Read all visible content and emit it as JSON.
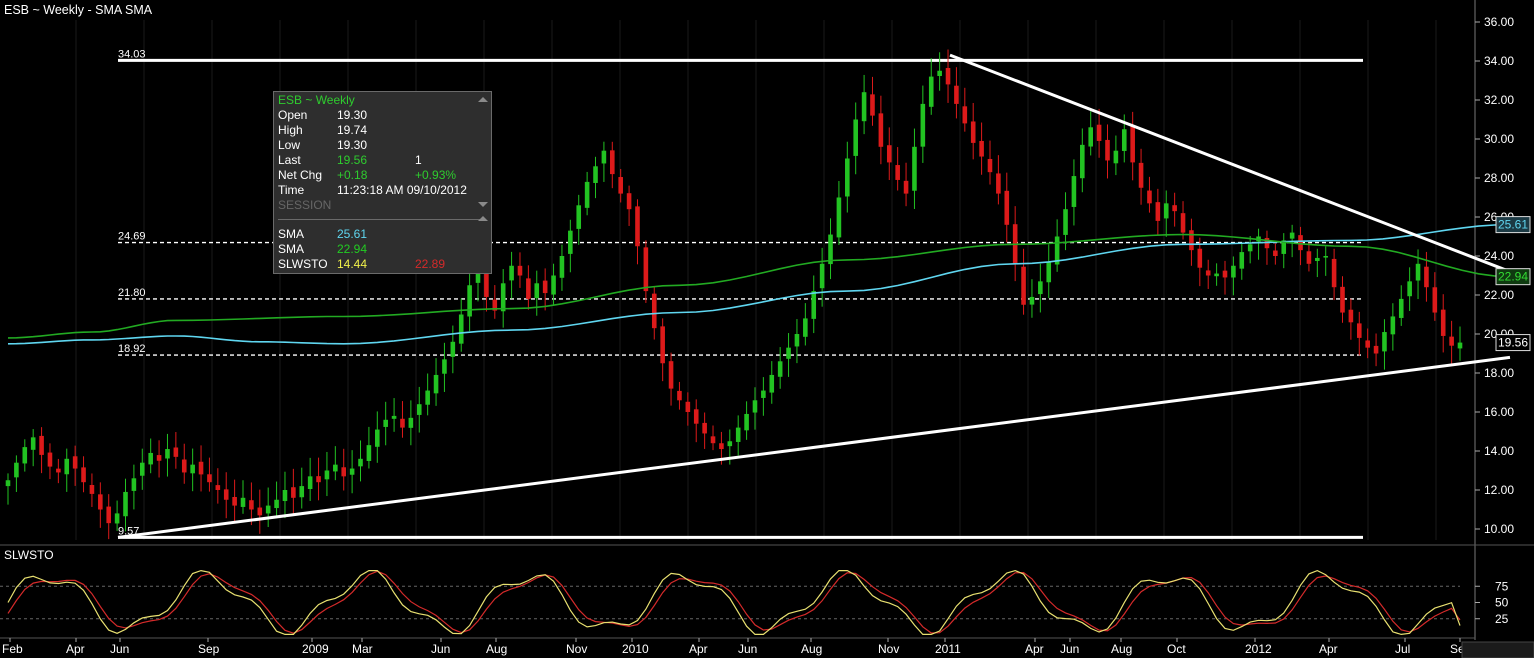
{
  "header": {
    "title": "ESB ~ Weekly  -  SMA SMA"
  },
  "colors": {
    "up": "#22c322",
    "down": "#dd1a1a",
    "sma_long": "#5fd6f0",
    "sma_short": "#22aa22",
    "stoch_k": "#e8e070",
    "stoch_d": "#d42a2a",
    "lines": "#ffffff"
  },
  "tooltip": {
    "title": "ESB ~ Weekly",
    "rows": [
      {
        "label": "Open",
        "value": "19.30",
        "color": "#ffffff"
      },
      {
        "label": "High",
        "value": "19.74",
        "color": "#ffffff"
      },
      {
        "label": "Low",
        "value": "19.30",
        "color": "#ffffff"
      },
      {
        "label": "Last",
        "value": "19.56",
        "value2": "1",
        "color": "#2ecc2e",
        "color2": "#ffffff"
      },
      {
        "label": "Net Chg",
        "value": "+0.18",
        "value2": "+0.93%",
        "color": "#2ecc2e",
        "color2": "#2ecc2e"
      },
      {
        "label": "Time",
        "value": "11:23:18 AM  09/10/2012",
        "color": "#ffffff"
      }
    ],
    "session_label": "SESSION",
    "indicators": [
      {
        "label": "SMA",
        "value": "25.61",
        "color": "#5fd6f0"
      },
      {
        "label": "SMA",
        "value": "22.94",
        "color": "#22cc22"
      },
      {
        "label": "SLWSTO",
        "value": "14.44",
        "value2": "22.89",
        "color": "#f0f04a",
        "color2": "#d42a2a"
      }
    ]
  },
  "chart_data": {
    "type": "line",
    "title": "ESB ~ Weekly",
    "y_axis": {
      "range": [
        9.0,
        36.8
      ],
      "ticks": [
        "10.00",
        "12.00",
        "14.00",
        "16.00",
        "18.00",
        "20.00",
        "22.00",
        "24.00",
        "26.00",
        "28.00",
        "30.00",
        "32.00",
        "34.00",
        "36.00"
      ]
    },
    "x_axis": {
      "labels": [
        "Feb",
        "Apr",
        "Jun",
        "Sep",
        "2009",
        "Mar",
        "Jun",
        "Aug",
        "Nov",
        "2010",
        "Apr",
        "Jun",
        "Aug",
        "Nov",
        "2011",
        "Apr",
        "Jun",
        "Aug",
        "Oct",
        "2012",
        "Apr",
        "Jul",
        "Sep"
      ]
    },
    "price_weekly_close": [
      12.5,
      13.4,
      14.2,
      14.7,
      13.8,
      13.2,
      12.9,
      13.6,
      13.1,
      12.4,
      11.8,
      11.0,
      10.3,
      10.8,
      11.9,
      12.6,
      13.4,
      13.9,
      13.5,
      14.1,
      13.7,
      12.9,
      13.3,
      12.8,
      12.4,
      12.0,
      11.5,
      11.2,
      11.6,
      11.0,
      10.7,
      11.2,
      11.5,
      12.0,
      11.6,
      12.2,
      12.7,
      12.4,
      13.0,
      13.3,
      12.7,
      13.1,
      13.6,
      14.3,
      15.1,
      15.6,
      15.8,
      15.2,
      15.7,
      16.4,
      17.1,
      17.9,
      18.7,
      19.6,
      21.0,
      22.5,
      23.2,
      21.9,
      21.2,
      22.6,
      23.5,
      23.0,
      21.8,
      22.6,
      22.1,
      23.0,
      24.0,
      25.3,
      26.6,
      27.8,
      28.6,
      29.4,
      28.2,
      27.2,
      26.4,
      24.5,
      22.2,
      20.3,
      18.5,
      17.2,
      16.6,
      16.0,
      15.4,
      14.9,
      14.4,
      14.1,
      14.5,
      15.2,
      15.9,
      16.6,
      17.1,
      17.9,
      18.6,
      19.3,
      20.0,
      20.8,
      22.2,
      23.6,
      25.1,
      27.0,
      29.0,
      31.0,
      32.4,
      31.2,
      29.6,
      28.8,
      27.9,
      27.2,
      29.6,
      31.8,
      33.2,
      33.5,
      32.8,
      31.8,
      30.8,
      29.8,
      29.1,
      28.3,
      27.2,
      25.6,
      23.6,
      21.5,
      21.9,
      22.7,
      23.7,
      25.0,
      26.4,
      28.1,
      29.7,
      30.6,
      29.9,
      28.9,
      29.4,
      30.5,
      28.8,
      27.5,
      26.7,
      25.8,
      26.7,
      26.3,
      25.2,
      24.3,
      23.4,
      23.0,
      23.1,
      22.9,
      23.5,
      24.2,
      24.6,
      25.0,
      24.4,
      24.0,
      24.8,
      25.2,
      24.3,
      23.6,
      23.9,
      24.0,
      22.4,
      21.1,
      20.6,
      19.8,
      19.3,
      19.0,
      20.1,
      20.9,
      21.8,
      22.7,
      23.6,
      22.4,
      21.1,
      19.9,
      19.4,
      19.56
    ],
    "series": [
      {
        "name": "SMA",
        "last": 25.61,
        "points": [
          [
            0,
            19.5
          ],
          [
            10,
            19.7
          ],
          [
            20,
            19.9
          ],
          [
            30,
            19.6
          ],
          [
            40,
            19.5
          ],
          [
            60,
            20.2
          ],
          [
            80,
            21.1
          ],
          [
            100,
            22.2
          ],
          [
            120,
            23.6
          ],
          [
            140,
            24.6
          ],
          [
            160,
            24.8
          ],
          [
            179,
            25.61
          ]
        ]
      },
      {
        "name": "SMA",
        "last": 22.94,
        "points": [
          [
            0,
            19.8
          ],
          [
            10,
            20.1
          ],
          [
            20,
            20.7
          ],
          [
            40,
            20.9
          ],
          [
            60,
            21.3
          ],
          [
            80,
            22.5
          ],
          [
            100,
            23.8
          ],
          [
            120,
            24.6
          ],
          [
            140,
            25.1
          ],
          [
            160,
            24.5
          ],
          [
            179,
            22.94
          ]
        ]
      }
    ],
    "levels": [
      34.03,
      24.69,
      21.8,
      18.92,
      9.57
    ],
    "level_labels": [
      "34.03",
      "24.69",
      "21.80",
      "18.92",
      "9.57"
    ],
    "trendlines": [
      {
        "from": [
          9.57,
          "Jun 2008"
        ],
        "to": [
          18.8,
          "Sep 2012"
        ]
      },
      {
        "from": [
          34.3,
          "Jan 2011"
        ],
        "to": [
          23.0,
          "Sep 2012"
        ]
      }
    ],
    "price_last_label": "19.56",
    "sma_last_labels": [
      "25.61",
      "22.94"
    ],
    "stochastic": {
      "name": "SLWSTO",
      "ticks": [
        "75",
        "50",
        "25"
      ],
      "range": [
        0,
        100
      ],
      "k_last": 14.44,
      "d_last": 22.89
    }
  }
}
